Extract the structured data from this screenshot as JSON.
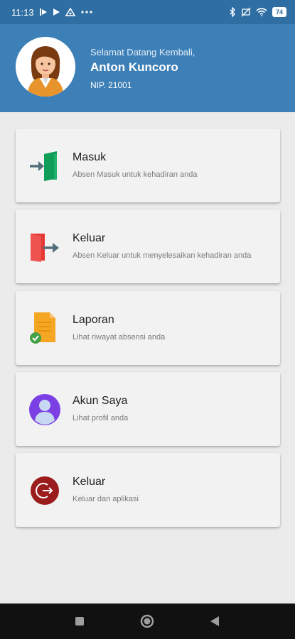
{
  "status_bar": {
    "time": "11:13",
    "battery": "74"
  },
  "header": {
    "greeting": "Selamat Datang Kembali,",
    "name": "Anton Kuncoro",
    "nip": "NIP. 21001"
  },
  "menu": [
    {
      "title": "Masuk",
      "description": "Absen Masuk untuk kehadiran anda",
      "icon": "door-enter-icon"
    },
    {
      "title": "Keluar",
      "description": "Absen Keluar untuk menyelesaikan kehadiran anda",
      "icon": "door-exit-icon"
    },
    {
      "title": "Laporan",
      "description": "Lihat riwayat absensi anda",
      "icon": "report-icon"
    },
    {
      "title": "Akun Saya",
      "description": "Lihat profil anda",
      "icon": "user-icon"
    },
    {
      "title": "Keluar",
      "description": "Keluar dari aplikasi",
      "icon": "logout-icon"
    }
  ],
  "colors": {
    "header": "#3d7fb7",
    "status_bar": "#2f6ea2",
    "background": "#ebebeb"
  }
}
